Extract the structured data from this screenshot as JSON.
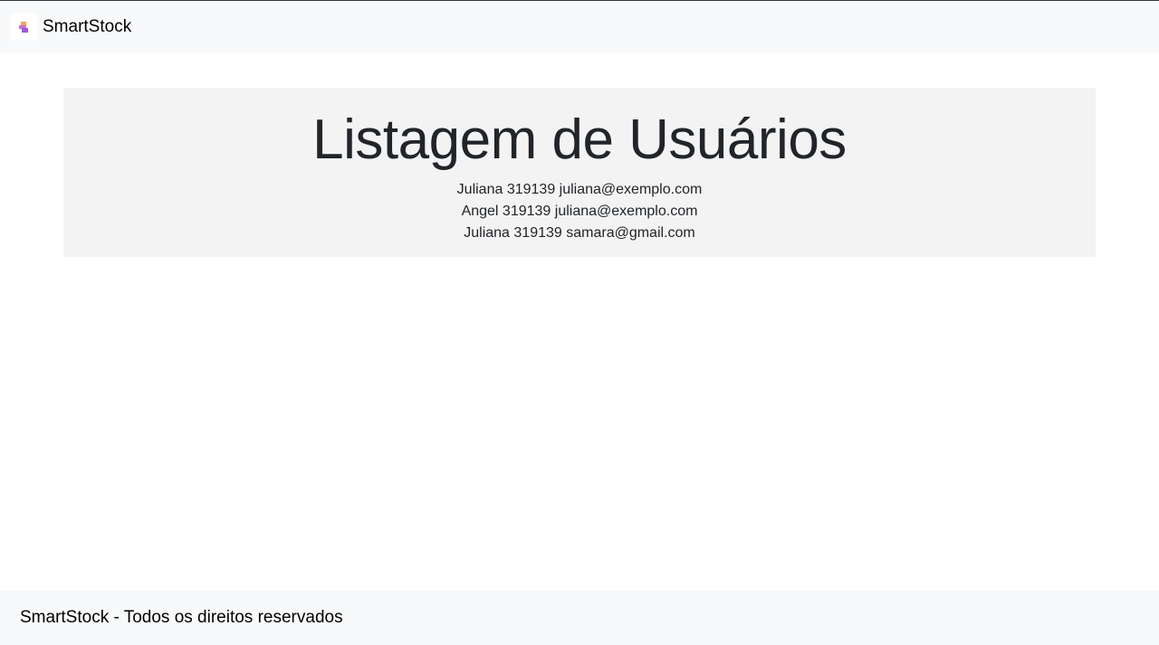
{
  "navbar": {
    "brand_name": "SmartStock",
    "logo_icon": "boxes-stack-logo-icon",
    "background": "#f8f9fa"
  },
  "main": {
    "title": "Listagem de Usuários",
    "users": [
      {
        "text": "Juliana 319139 juliana@exemplo.com"
      },
      {
        "text": "Angel 319139 juliana@exemplo.com"
      },
      {
        "text": "Juliana 319139 samara@gmail.com"
      }
    ],
    "panel_background": "#f3f3f3"
  },
  "footer": {
    "text": "SmartStock - Todos os direitos reservados"
  }
}
